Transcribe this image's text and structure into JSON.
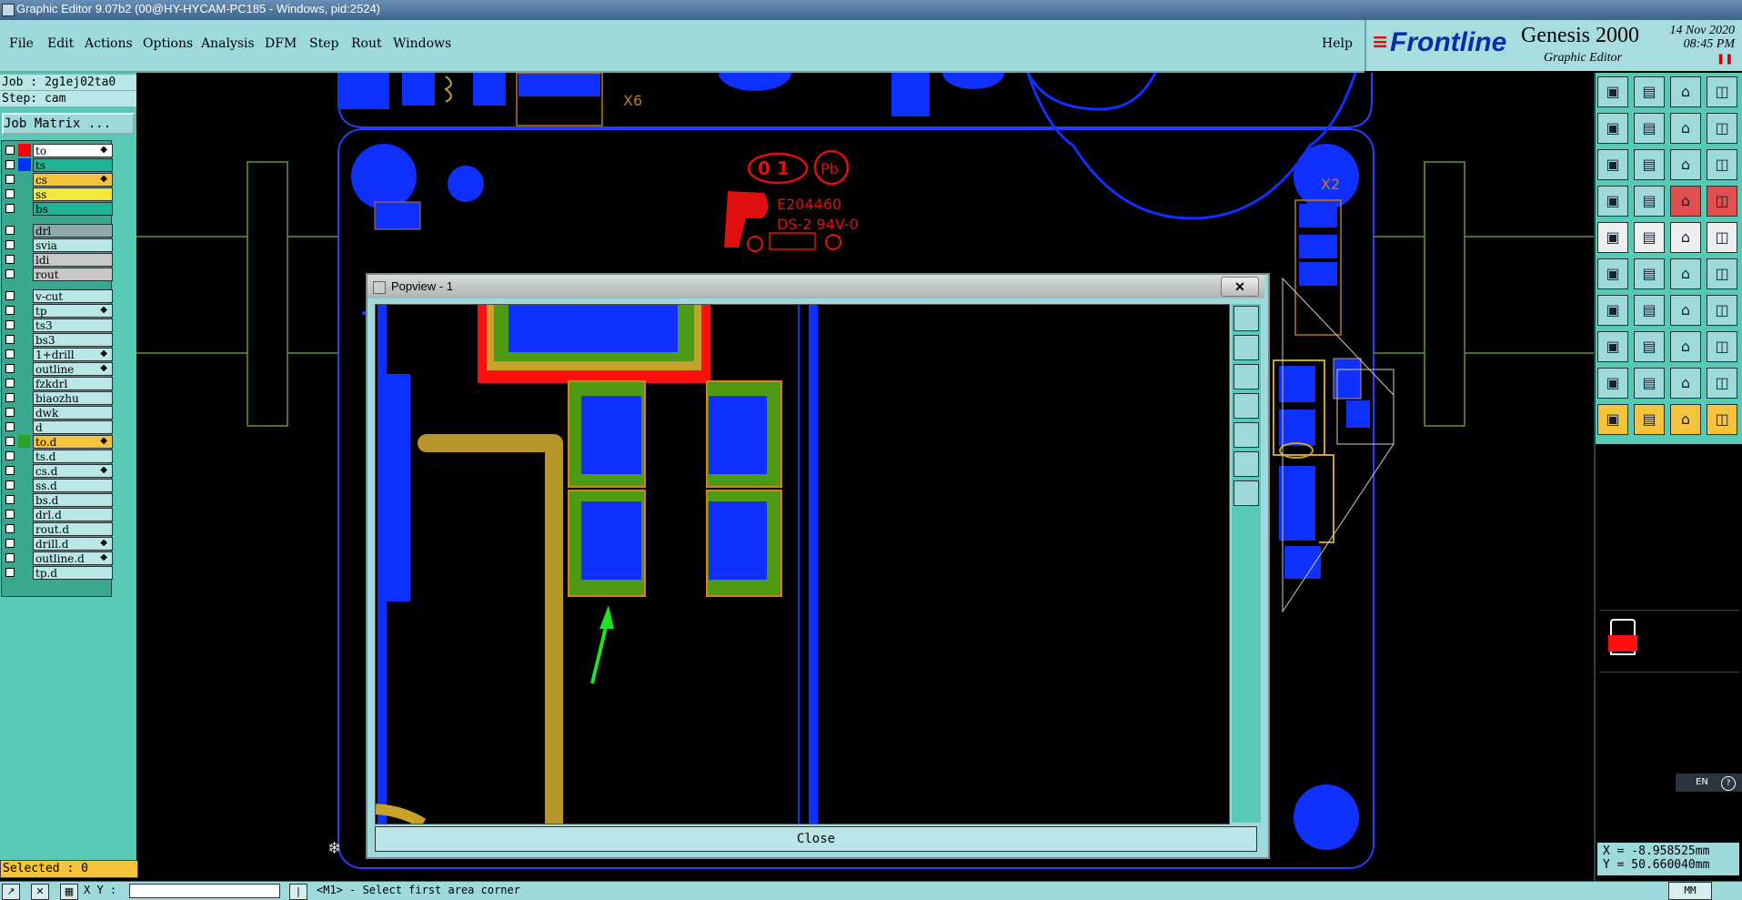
{
  "window": {
    "title": "Graphic Editor 9.07b2 (00@HY-HYCAM-PC185 - Windows, pid:2524)"
  },
  "menu": {
    "items": [
      "File",
      "Edit",
      "Actions",
      "Options",
      "Analysis",
      "DFM",
      "Step",
      "Rout",
      "Windows"
    ],
    "help": "Help"
  },
  "brand": {
    "logo": "Frontline",
    "product": "Genesis 2000",
    "subtitle": "Graphic Editor",
    "date": "14 Nov 2020",
    "time": "08:45 PM"
  },
  "job": {
    "job_line": "Job : 2g1ej02ta0",
    "step_line": "Step: cam",
    "matrix_button": "Job Matrix ..."
  },
  "layers": [
    {
      "name": "to",
      "color": "#ff0000",
      "bg": "#ffffff",
      "mark": "◆"
    },
    {
      "name": "ts",
      "color": "#0033ff",
      "bg": "#1fb394",
      "mark": ""
    },
    {
      "name": "cs",
      "color": "",
      "bg": "#f5c33c",
      "mark": "◆"
    },
    {
      "name": "ss",
      "color": "",
      "bg": "#f5e63c",
      "mark": ""
    },
    {
      "name": "bs",
      "color": "",
      "bg": "#1fb394",
      "mark": ""
    },
    {
      "name": "drl",
      "color": "",
      "bg": "#8faaaa",
      "mark": ""
    },
    {
      "name": "svia",
      "color": "",
      "bg": "#b9e6e6",
      "mark": ""
    },
    {
      "name": "ldi",
      "color": "",
      "bg": "#c8c8c8",
      "mark": ""
    },
    {
      "name": "rout",
      "color": "",
      "bg": "#c8c8c8",
      "mark": ""
    },
    {
      "name": "v-cut",
      "color": "",
      "bg": "#b9e6e6",
      "mark": ""
    },
    {
      "name": "tp",
      "color": "",
      "bg": "#b9e6e6",
      "mark": "◆"
    },
    {
      "name": "ts3",
      "color": "",
      "bg": "#b9e6e6",
      "mark": ""
    },
    {
      "name": "bs3",
      "color": "",
      "bg": "#b9e6e6",
      "mark": ""
    },
    {
      "name": "1+drill",
      "color": "",
      "bg": "#b9e6e6",
      "mark": "◆"
    },
    {
      "name": "outline",
      "color": "",
      "bg": "#b9e6e6",
      "mark": "◆"
    },
    {
      "name": "fzkdrl",
      "color": "",
      "bg": "#b9e6e6",
      "mark": ""
    },
    {
      "name": "biaozhu",
      "color": "",
      "bg": "#b9e6e6",
      "mark": ""
    },
    {
      "name": "dwk",
      "color": "",
      "bg": "#b9e6e6",
      "mark": ""
    },
    {
      "name": "d",
      "color": "",
      "bg": "#b9e6e6",
      "mark": ""
    },
    {
      "name": "to.d",
      "color": "#2ea02e",
      "bg": "#f5c33c",
      "mark": "◆"
    },
    {
      "name": "ts.d",
      "color": "",
      "bg": "#b9e6e6",
      "mark": ""
    },
    {
      "name": "cs.d",
      "color": "",
      "bg": "#b9e6e6",
      "mark": "◆"
    },
    {
      "name": "ss.d",
      "color": "",
      "bg": "#b9e6e6",
      "mark": ""
    },
    {
      "name": "bs.d",
      "color": "",
      "bg": "#b9e6e6",
      "mark": ""
    },
    {
      "name": "drl.d",
      "color": "",
      "bg": "#b9e6e6",
      "mark": ""
    },
    {
      "name": "rout.d",
      "color": "",
      "bg": "#b9e6e6",
      "mark": ""
    },
    {
      "name": "drill.d",
      "color": "",
      "bg": "#b9e6e6",
      "mark": "◆"
    },
    {
      "name": "outline.d",
      "color": "",
      "bg": "#b9e6e6",
      "mark": "◆"
    },
    {
      "name": "tp.d",
      "color": "",
      "bg": "#b9e6e6",
      "mark": ""
    }
  ],
  "status": {
    "selected": "Selected : 0",
    "xy_label": "X Y :",
    "prompt": "<M1> - Select first area corner"
  },
  "board": {
    "labels": {
      "x6": "X6",
      "x2": "X2"
    },
    "marking": {
      "code": "0 1",
      "cert": "E204460",
      "spec": "DS-2  94V-0",
      "pb": "Pb"
    }
  },
  "popview": {
    "title": "Popview - 1",
    "close_x": "✕",
    "close_button": "Close"
  },
  "coords": {
    "x": "X = -8.958525mm",
    "y": "Y = 50.660040mm"
  },
  "lang_badge": "EN",
  "unit_badge": "MM"
}
